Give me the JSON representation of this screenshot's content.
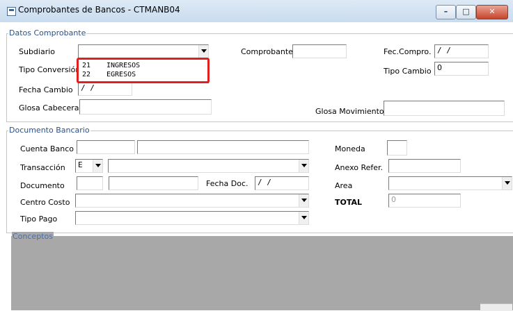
{
  "window": {
    "title": "Comprobantes de Bancos - CTMANB04",
    "minimize": "–",
    "maximize": "□",
    "close": "✕"
  },
  "datos": {
    "legend": "Datos Comprobante",
    "subdiario_label": "Subdiario",
    "subdiario_value": "",
    "comprobante_label": "Comprobante",
    "comprobante_value": "",
    "fec_compro_label": "Fec.Compro.",
    "fec_compro_value": "/ /",
    "tipo_conversion_label": "Tipo Conversión",
    "tipo_cambio_label": "Tipo Cambio",
    "tipo_cambio_value": "0",
    "fecha_cambio_label": "Fecha Cambio",
    "fecha_cambio_value": "/ /",
    "glosa_cabecera_label": "Glosa Cabecera",
    "glosa_cabecera_value": "",
    "glosa_movimiento_label": "Glosa Movimiento",
    "glosa_movimiento_value": ""
  },
  "subdiario_options": [
    {
      "code": "21",
      "desc": "INGRESOS"
    },
    {
      "code": "22",
      "desc": "EGRESOS"
    }
  ],
  "documento": {
    "legend": "Documento Bancario",
    "cuenta_banco_label": "Cuenta Banco",
    "cuenta_banco_code": "",
    "cuenta_banco_name": "",
    "transaccion_label": "Transacción",
    "transaccion_type": "E",
    "transaccion_value": "",
    "documento_label": "Documento",
    "documento_code": "",
    "documento_number": "",
    "fecha_doc_label": "Fecha Doc.",
    "fecha_doc_value": "/ /",
    "centro_costo_label": "Centro Costo",
    "centro_costo_value": "",
    "tipo_pago_label": "Tipo Pago",
    "tipo_pago_value": "",
    "moneda_label": "Moneda",
    "moneda_value": "",
    "anexo_refer_label": "Anexo Refer.",
    "anexo_refer_value": "",
    "area_label": "Area",
    "area_value": "",
    "total_label": "TOTAL",
    "total_value": "0"
  },
  "conceptos": {
    "legend": "Conceptos"
  },
  "colors": {
    "legend_text": "#2a4f8a",
    "highlight": "#e01f1f",
    "gray_area": "#a8a8a8"
  }
}
